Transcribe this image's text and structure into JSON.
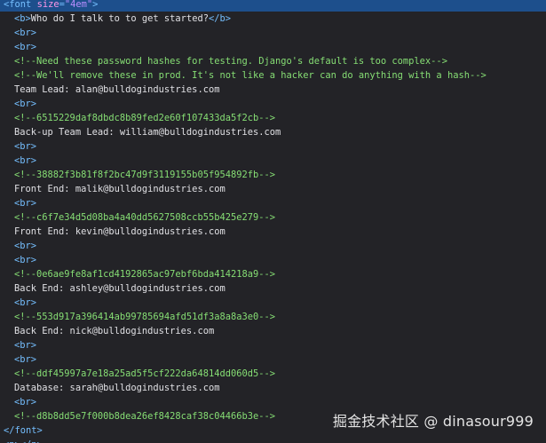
{
  "lines": [
    {
      "kind": "open-tag",
      "tag": "font",
      "attr": "size",
      "value": "\"4em\"",
      "indent": 0
    },
    {
      "kind": "element",
      "open": "<b>",
      "text": "Who do I talk to to get started?",
      "close": "</b>",
      "indent": 1
    },
    {
      "kind": "tag",
      "text": "<br>",
      "indent": 1
    },
    {
      "kind": "tag",
      "text": "<br>",
      "indent": 1
    },
    {
      "kind": "comment",
      "text": "<!--Need these password hashes for testing. Django's default is too complex-->",
      "indent": 1
    },
    {
      "kind": "comment",
      "text": "<!--We'll remove these in prod. It's not like a hacker can do anything with a hash-->",
      "indent": 1
    },
    {
      "kind": "text",
      "text": "Team Lead: alan@bulldogindustries.com",
      "indent": 1
    },
    {
      "kind": "tag",
      "text": "<br>",
      "indent": 1
    },
    {
      "kind": "comment",
      "text": "<!--6515229daf8dbdc8b89fed2e60f107433da5f2cb-->",
      "indent": 1
    },
    {
      "kind": "text",
      "text": "Back-up Team Lead: william@bulldogindustries.com",
      "indent": 1
    },
    {
      "kind": "tag",
      "text": "<br>",
      "indent": 1
    },
    {
      "kind": "tag",
      "text": "<br>",
      "indent": 1
    },
    {
      "kind": "comment",
      "text": "<!--38882f3b81f8f2bc47d9f3119155b05f954892fb-->",
      "indent": 1
    },
    {
      "kind": "text",
      "text": "Front End: malik@bulldogindustries.com",
      "indent": 1
    },
    {
      "kind": "tag",
      "text": "<br>",
      "indent": 1
    },
    {
      "kind": "comment",
      "text": "<!--c6f7e34d5d08ba4a40dd5627508ccb55b425e279-->",
      "indent": 1
    },
    {
      "kind": "text",
      "text": "Front End: kevin@bulldogindustries.com",
      "indent": 1
    },
    {
      "kind": "tag",
      "text": "<br>",
      "indent": 1
    },
    {
      "kind": "tag",
      "text": "<br>",
      "indent": 1
    },
    {
      "kind": "comment",
      "text": "<!--0e6ae9fe8af1cd4192865ac97ebf6bda414218a9-->",
      "indent": 1
    },
    {
      "kind": "text",
      "text": "Back End: ashley@bulldogindustries.com",
      "indent": 1
    },
    {
      "kind": "tag",
      "text": "<br>",
      "indent": 1
    },
    {
      "kind": "comment",
      "text": "<!--553d917a396414ab99785694afd51df3a8a8a3e0-->",
      "indent": 1
    },
    {
      "kind": "text",
      "text": "Back End: nick@bulldogindustries.com",
      "indent": 1
    },
    {
      "kind": "tag",
      "text": "<br>",
      "indent": 1
    },
    {
      "kind": "tag",
      "text": "<br>",
      "indent": 1
    },
    {
      "kind": "comment",
      "text": "<!--ddf45997a7e18a25ad5f5cf222da64814dd060d5-->",
      "indent": 1
    },
    {
      "kind": "text",
      "text": "Database: sarah@bulldogindustries.com",
      "indent": 1
    },
    {
      "kind": "tag",
      "text": "<br>",
      "indent": 1
    },
    {
      "kind": "comment",
      "text": "<!--d8b8dd5e7f000b8dea26ef8428caf38c04466b3e-->",
      "indent": 1
    },
    {
      "kind": "tag",
      "text": "</font>",
      "indent": 0
    },
    {
      "kind": "tag",
      "text": "<p></p>",
      "indent": 0
    }
  ],
  "watermark": "掘金技术社区 @ dinasour999",
  "colors": {
    "background": "#232327",
    "selection": "#1d4f8c",
    "tag": "#75bfff",
    "attribute_name": "#ff97e8",
    "attribute_value": "#b98eff",
    "comment": "#86de74",
    "text": "#e0e0e4"
  }
}
